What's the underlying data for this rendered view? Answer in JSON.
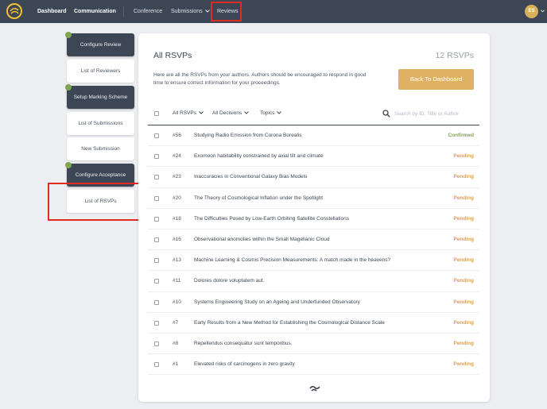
{
  "nav": {
    "dashboard": "Dashboard",
    "communication": "Communication",
    "conference": "Conference",
    "submissions": "Submissions",
    "reviews": "Reviews",
    "avatar_initials": "ES"
  },
  "sidebar": {
    "items": [
      {
        "label": "Configure Review",
        "style": "dark",
        "done": true
      },
      {
        "label": "List of Reviewers",
        "style": "light",
        "done": false
      },
      {
        "label": "Setup Marking Scheme",
        "style": "dark",
        "done": true
      },
      {
        "label": "List of Submissions",
        "style": "light",
        "done": false
      },
      {
        "label": "New Submission",
        "style": "light",
        "done": false
      },
      {
        "label": "Configure Acceptance",
        "style": "dark",
        "done": true
      },
      {
        "label": "List of RSVPs",
        "style": "light",
        "done": false
      }
    ]
  },
  "main": {
    "title": "All RSVPs",
    "count": "12 RSVPs",
    "description": "Here are all the RSVPs from your authors. Authors should be encouraged to respond in good time to ensure correct information for your proceedings.",
    "back_button": "Back To Dashboard"
  },
  "filters": {
    "rsvps": "All RSVPs",
    "decisions": "All Decisions",
    "topics": "Topics",
    "search_placeholder": "Search by ID, Title or Author"
  },
  "rows": [
    {
      "id": "#56",
      "title": "Studying Radio Emission from Corona Borealis",
      "status": "Confirmed"
    },
    {
      "id": "#24",
      "title": "Exomoon habitability constrained by axial tilt and climate",
      "status": "Pending"
    },
    {
      "id": "#23",
      "title": "Inaccuracies in Conventional Galaxy Bias Models",
      "status": "Pending"
    },
    {
      "id": "#20",
      "title": "The Theory of Cosmological Inflation under the Spotlight",
      "status": "Pending"
    },
    {
      "id": "#18",
      "title": "The Difficulties Posed by Low-Earth Orbiting Satellite Constellations",
      "status": "Pending"
    },
    {
      "id": "#16",
      "title": "Observational anomolies within the Small Magellanic Cloud",
      "status": "Pending"
    },
    {
      "id": "#13",
      "title": "Machine Learning & Cosmis Precision Measurements: A match made in the heavens?",
      "status": "Pending"
    },
    {
      "id": "#11",
      "title": "Dolores dolore voluptatem aut.",
      "status": "Pending"
    },
    {
      "id": "#10",
      "title": "Systems Engineering Study on an Ageing and Underfunded Observatory",
      "status": "Pending"
    },
    {
      "id": "#7",
      "title": "Early Results from a New Method for Establishing the Cosmological Distance Scale",
      "status": "Pending"
    },
    {
      "id": "#8",
      "title": "Repellendus consequatur sunt temporibus.",
      "status": "Pending"
    },
    {
      "id": "#1",
      "title": "Elevated risks of carcinogens in zero gravity",
      "status": "Pending"
    }
  ],
  "colors": {
    "topbar": "#3d4654",
    "confirmed": "#7fa651",
    "pending": "#dfa13e",
    "accent": "#dfb162",
    "highlight": "#e02b20"
  }
}
